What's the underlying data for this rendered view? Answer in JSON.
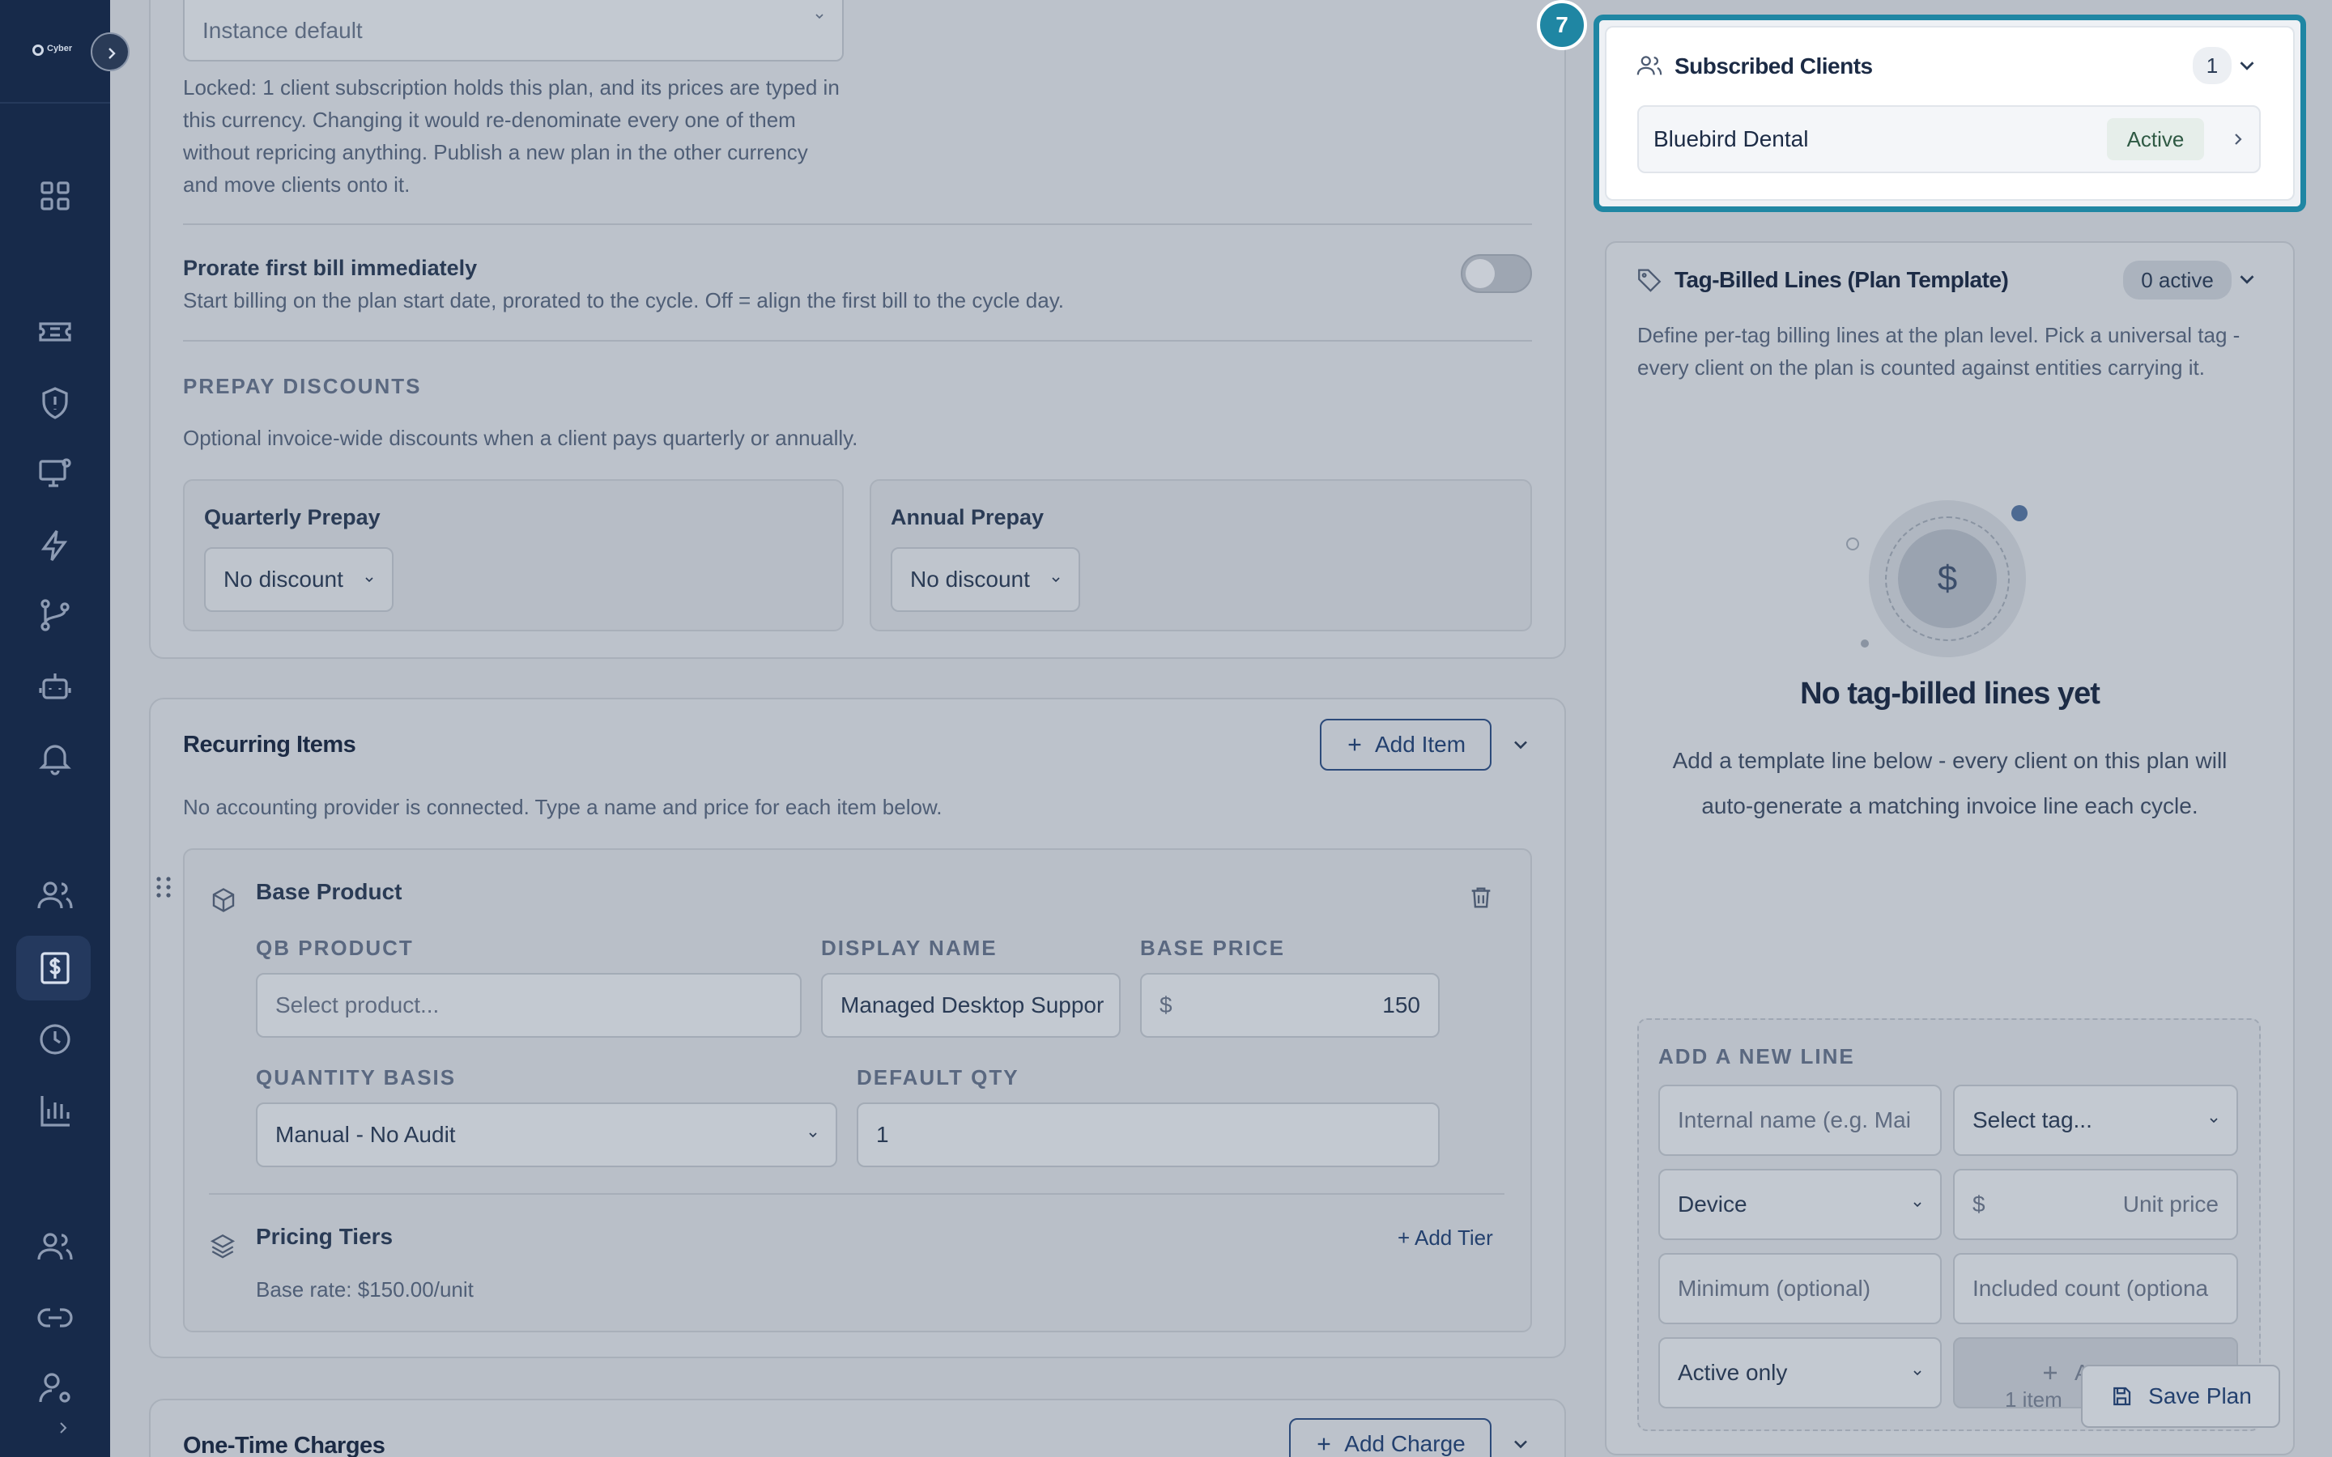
{
  "sidebar": {
    "logo_text": "Cyber",
    "icons": [
      "dashboard-icon",
      "ticket-icon",
      "shield-icon",
      "monitor-icon",
      "bolt-icon",
      "branch-icon",
      "robot-icon",
      "bell-icon",
      "users-icon",
      "billing-icon",
      "clock-icon",
      "chart-icon",
      "team-icon",
      "link-icon",
      "user-settings-icon"
    ]
  },
  "currency_section": {
    "select_value": "Instance default",
    "locked_note_line1": "Locked: 1 client subscription holds this plan, and its prices are typed in",
    "locked_note_line2": "this currency. Changing it would re-denominate every one of them",
    "locked_note_line3": "without repricing anything. Publish a new plan in the other currency",
    "locked_note_line4": "and move clients onto it."
  },
  "prorate": {
    "title": "Prorate first bill immediately",
    "desc": "Start billing on the plan start date, prorated to the cycle. Off = align the first bill to the cycle day.",
    "enabled": false
  },
  "prepay": {
    "heading": "PREPAY DISCOUNTS",
    "desc": "Optional invoice-wide discounts when a client pays quarterly or annually.",
    "quarterly": {
      "label": "Quarterly Prepay",
      "value": "No discount"
    },
    "annual": {
      "label": "Annual Prepay",
      "value": "No discount"
    }
  },
  "recurring": {
    "title": "Recurring Items",
    "add_label": "Add Item",
    "note": "No accounting provider is connected. Type a name and price for each item below.",
    "item": {
      "title": "Base Product",
      "qb_label": "QB PRODUCT",
      "qb_placeholder": "Select product...",
      "display_label": "DISPLAY NAME",
      "display_value": "Managed Desktop Suppor",
      "price_label": "BASE PRICE",
      "currency_symbol": "$",
      "price_value": "150",
      "qty_basis_label": "QUANTITY BASIS",
      "qty_basis_value": "Manual - No Audit",
      "default_qty_label": "DEFAULT QTY",
      "default_qty_value": "1",
      "tiers_title": "Pricing Tiers",
      "add_tier": "+ Add Tier",
      "base_rate": "Base rate: $150.00/unit"
    }
  },
  "one_time": {
    "title": "One-Time Charges",
    "add_label": "Add Charge"
  },
  "subscribed_clients": {
    "step": "7",
    "title": "Subscribed Clients",
    "count": "1",
    "client_name": "Bluebird Dental",
    "client_status": "Active"
  },
  "tag_lines": {
    "title": "Tag-Billed Lines (Plan Template)",
    "badge": "0 active",
    "desc_line1": "Define per-tag billing lines at the plan level. Pick a universal tag -",
    "desc_line2": "every client on the plan is counted against entities carrying it.",
    "empty_symbol": "$",
    "empty_title": "No tag-billed lines yet",
    "empty_desc_line1": "Add a template line below - every client on this plan will",
    "empty_desc_line2": "auto-generate a matching invoice line each cycle.",
    "add_heading": "ADD A NEW LINE",
    "name_placeholder": "Internal name (e.g. Mai",
    "tag_placeholder": "Select tag...",
    "entity_value": "Device",
    "currency_symbol": "$",
    "unit_price_placeholder": "Unit price",
    "minimum_placeholder": "Minimum (optional)",
    "included_placeholder": "Included count (optiona",
    "filter_value": "Active only",
    "add_button_partial": "A",
    "item_count": "1 item"
  },
  "save_button": "Save Plan",
  "colors": {
    "accent": "#1f86a3",
    "sidebar": "#172a4a",
    "overlay": "#b9bfc8"
  }
}
